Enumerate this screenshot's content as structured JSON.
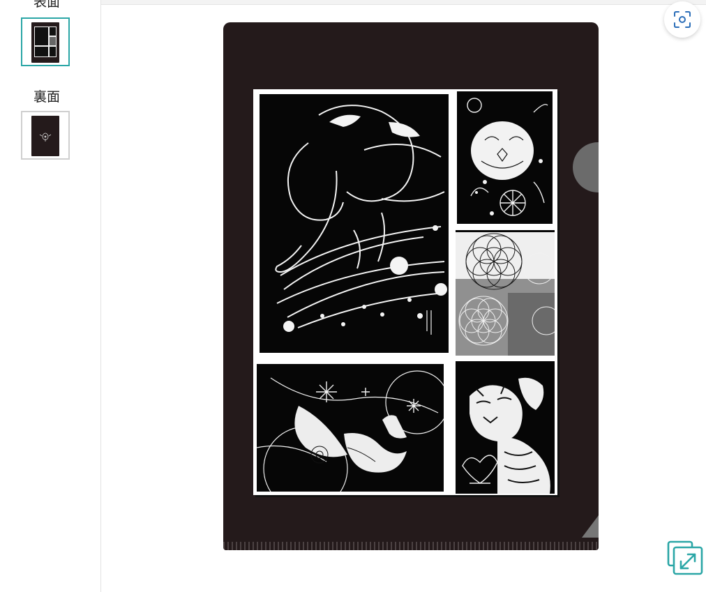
{
  "sidebar": {
    "front_label": "表面",
    "back_label": "裏面"
  },
  "icons": {
    "scan": "scan-icon",
    "expand": "expand-icon"
  },
  "colors": {
    "accent": "#2aa6a6",
    "folder": "#241a1b"
  }
}
